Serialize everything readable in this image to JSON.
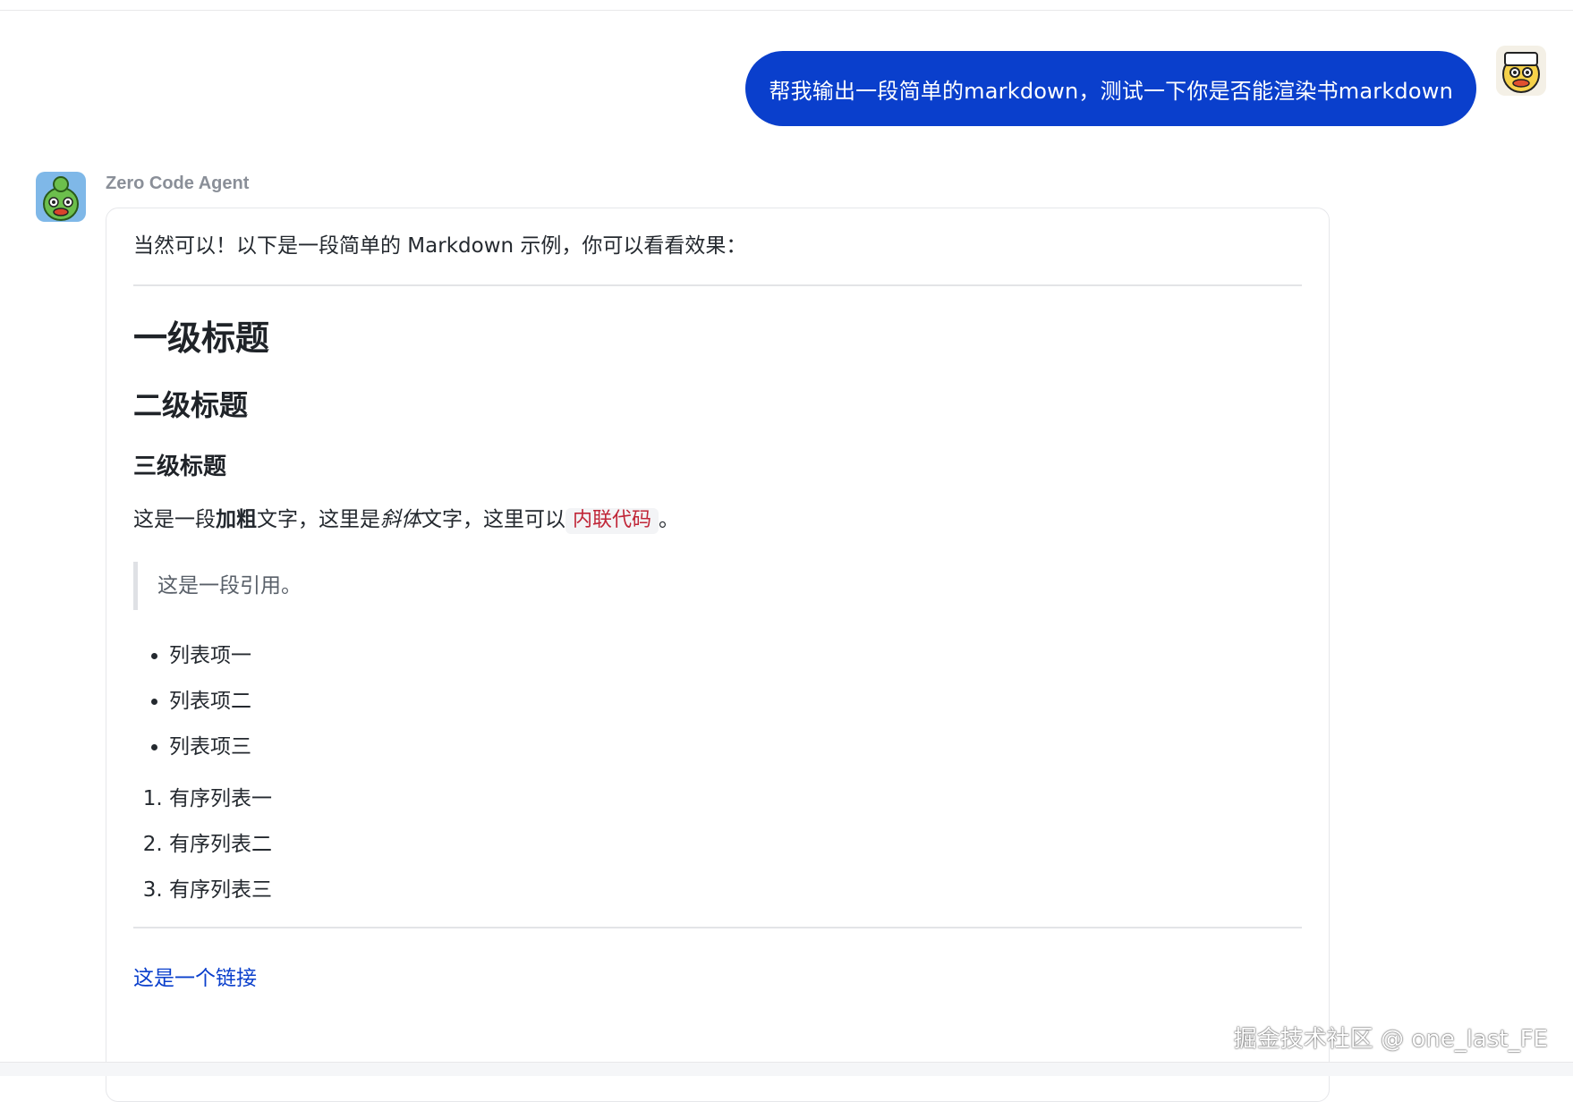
{
  "user_message": {
    "text": "帮我输出一段简单的markdown，测试一下你是否能渲染书markdown",
    "bubble_color": "#0a3fcc"
  },
  "agent": {
    "name": "Zero Code Agent",
    "intro": "当然可以！以下是一段简单的 Markdown 示例，你可以看看效果：",
    "h1": "一级标题",
    "h2": "二级标题",
    "h3": "三级标题",
    "paragraph": {
      "part1": "这是一段",
      "bold": "加粗",
      "part2": "文字，这里是",
      "italic": "斜体",
      "part3": "文字，这里可以",
      "code": "内联代码",
      "part4": "。"
    },
    "quote": "这是一段引用。",
    "bullets": [
      "列表项一",
      "列表项二",
      "列表项三"
    ],
    "ordered": [
      "有序列表一",
      "有序列表二",
      "有序列表三"
    ],
    "link": "这是一个链接"
  },
  "watermark": "掘金技术社区 @ one_last_FE",
  "colors": {
    "accent": "#0a3fcc",
    "code_text": "#c02537",
    "link": "#0a3fcc"
  }
}
